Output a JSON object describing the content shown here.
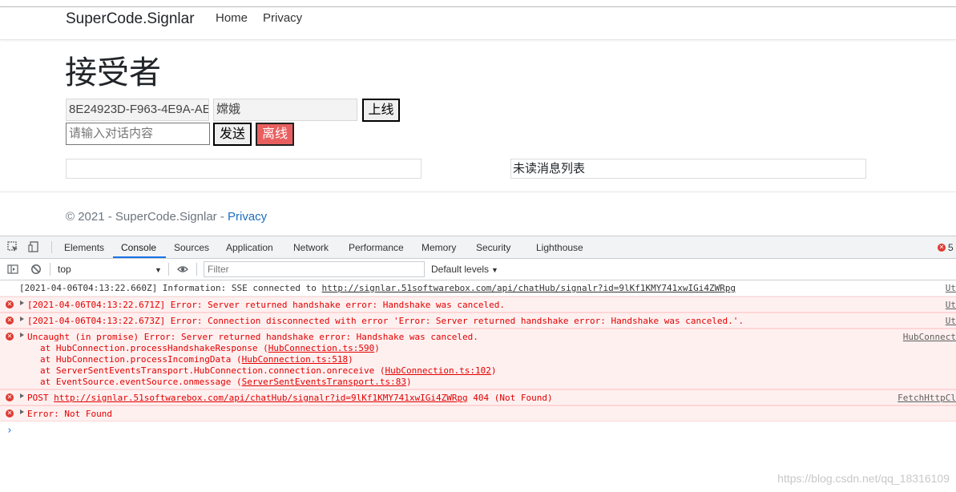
{
  "navbar": {
    "brand": "SuperCode.Signlar",
    "links": [
      "Home",
      "Privacy"
    ]
  },
  "page": {
    "title": "接受者",
    "id_input_value": "8E24923D-F963-4E9A-AE",
    "name_input_value": "嫦娥",
    "online_button": "上线",
    "message_placeholder": "请输入对话内容",
    "send_button": "发送",
    "offline_button": "离线",
    "unread_list_label": "未读消息列表"
  },
  "footer": {
    "text": "© 2021 - SuperCode.Signlar - ",
    "link": "Privacy"
  },
  "devtools": {
    "tabs": [
      "Elements",
      "Console",
      "Sources",
      "Application",
      "Network",
      "Performance",
      "Memory",
      "Security",
      "Lighthouse"
    ],
    "active_tab": "Console",
    "error_count": "5",
    "context": "top",
    "filter_placeholder": "Filter",
    "levels": "Default levels",
    "messages": [
      {
        "type": "info",
        "pre": "[2021-04-06T04:13:22.660Z] Information: SSE connected to ",
        "link": "http://signlar.51softwarebox.com/api/chatHub/signalr?id=9lKf1KMY741xwIGi4ZWRpg",
        "source": "Ut"
      },
      {
        "type": "error",
        "text": "[2021-04-06T04:13:22.671Z] Error: Server returned handshake error: Handshake was canceled.",
        "source": "Ut"
      },
      {
        "type": "error",
        "text": "[2021-04-06T04:13:22.673Z] Error: Connection disconnected with error 'Error: Server returned handshake error: Handshake was canceled.'.",
        "source": "Ut"
      },
      {
        "type": "error",
        "text": "Uncaught (in promise) Error: Server returned handshake error: Handshake was canceled.",
        "source": "HubConnect"
      },
      {
        "type": "error",
        "pre": "POST ",
        "link": "http://signlar.51softwarebox.com/api/chatHub/signalr?id=9lKf1KMY741xwIGi4ZWRpg",
        "post": " 404 (Not Found)",
        "source": "FetchHttpCl"
      },
      {
        "type": "error",
        "text": "Error: Not Found"
      }
    ],
    "stack": [
      {
        "pre": "at HubConnection.processHandshakeResponse (",
        "link": "HubConnection.ts:590",
        "post": ")"
      },
      {
        "pre": "at HubConnection.processIncomingData (",
        "link": "HubConnection.ts:518",
        "post": ")"
      },
      {
        "pre": "at ServerSentEventsTransport.HubConnection.connection.onreceive (",
        "link": "HubConnection.ts:102",
        "post": ")"
      },
      {
        "pre": "at EventSource.eventSource.onmessage (",
        "link": "ServerSentEventsTransport.ts:83",
        "post": ")"
      }
    ]
  },
  "watermark": "https://blog.csdn.net/qq_18316109"
}
